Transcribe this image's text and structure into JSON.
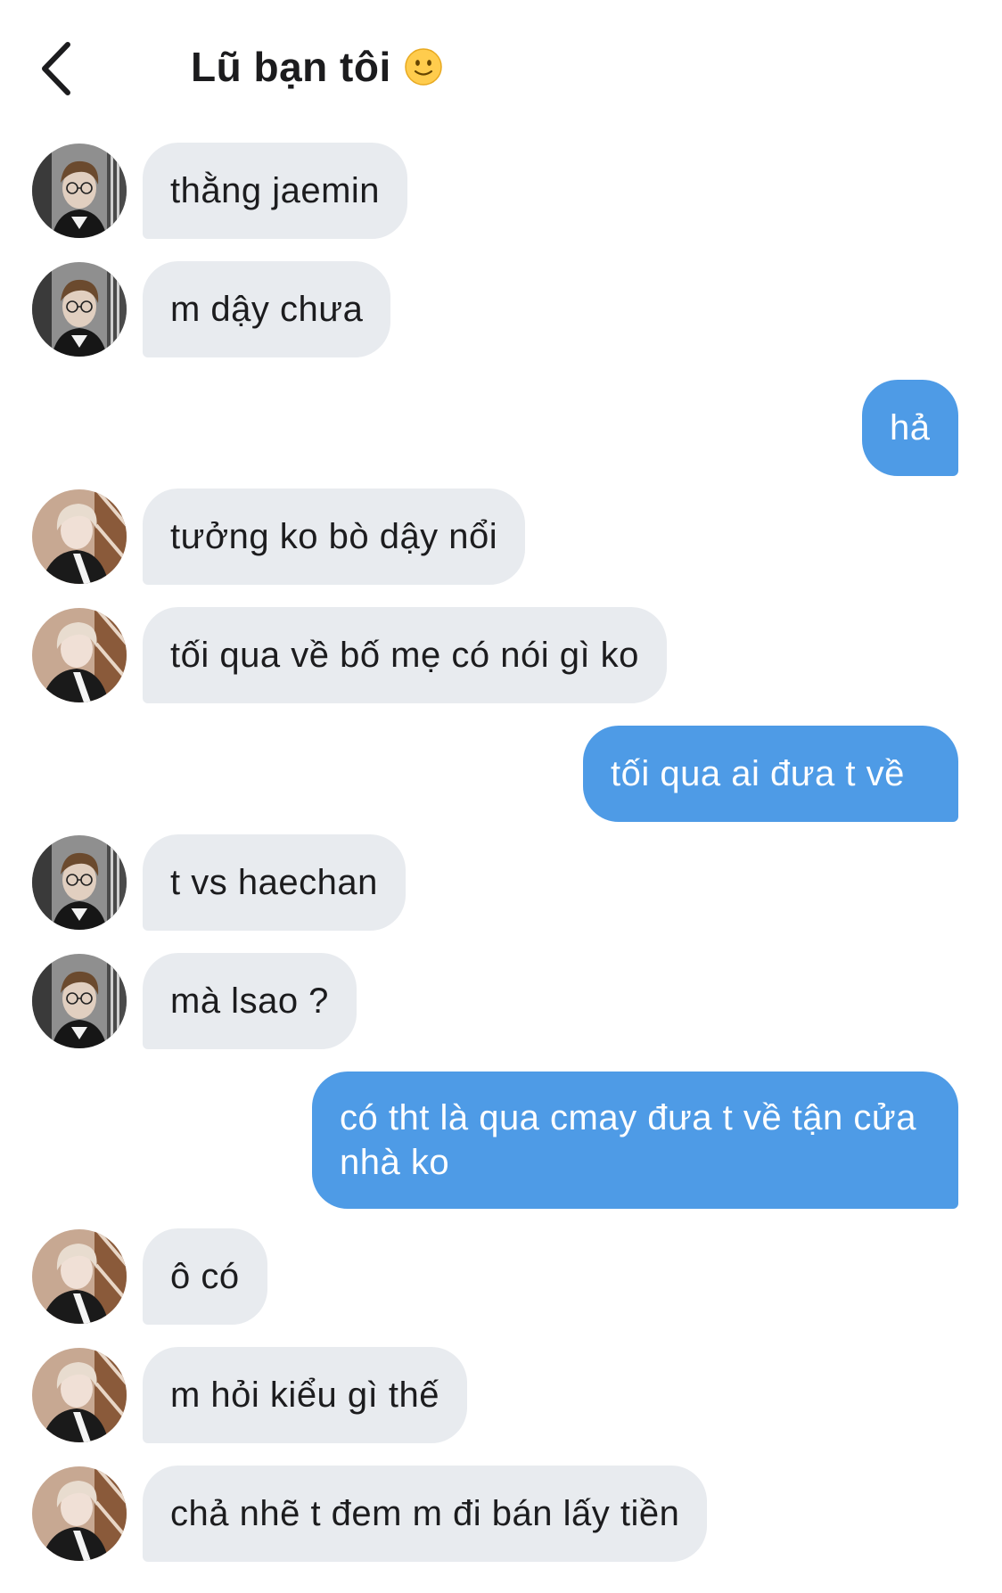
{
  "header": {
    "title": "Lũ bạn tôi"
  },
  "messages": [
    {
      "dir": "in",
      "avatar": "a",
      "text": "thằng jaemin"
    },
    {
      "dir": "in",
      "avatar": "a",
      "text": "m dậy chưa"
    },
    {
      "dir": "out",
      "text": "hả"
    },
    {
      "dir": "in",
      "avatar": "b",
      "text": "tưởng ko bò dậy nổi"
    },
    {
      "dir": "in",
      "avatar": "b",
      "text": "tối qua về bố mẹ có nói gì ko"
    },
    {
      "dir": "out",
      "text": "tối qua ai đưa t về"
    },
    {
      "dir": "in",
      "avatar": "a",
      "text": "t vs haechan"
    },
    {
      "dir": "in",
      "avatar": "a",
      "text": "mà lsao ?"
    },
    {
      "dir": "out",
      "text": "có tht là qua cmay đưa t về tận cửa nhà ko"
    },
    {
      "dir": "in",
      "avatar": "b",
      "text": "ô có"
    },
    {
      "dir": "in",
      "avatar": "b",
      "text": "m hỏi kiểu gì thế"
    },
    {
      "dir": "in",
      "avatar": "b",
      "text": "chả nhẽ t đem m đi bán lấy tiền"
    }
  ]
}
